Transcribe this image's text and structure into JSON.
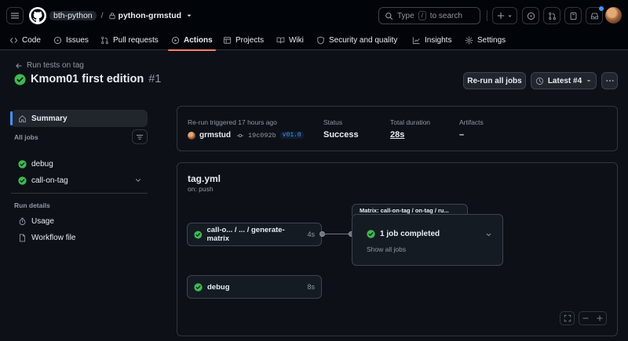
{
  "topbar": {
    "owner": "bth-python",
    "separator": "/",
    "repo": "python-grmstud",
    "search_prefix": "Type",
    "search_key": "/",
    "search_suffix": "to search"
  },
  "tabs": [
    {
      "label": "Code",
      "icon": "code-icon"
    },
    {
      "label": "Issues",
      "icon": "issue-icon"
    },
    {
      "label": "Pull requests",
      "icon": "pull-request-icon"
    },
    {
      "label": "Actions",
      "icon": "play-icon",
      "active": true
    },
    {
      "label": "Projects",
      "icon": "table-icon"
    },
    {
      "label": "Wiki",
      "icon": "book-icon"
    },
    {
      "label": "Security and quality",
      "icon": "shield-icon"
    },
    {
      "label": "Insights",
      "icon": "graph-icon"
    },
    {
      "label": "Settings",
      "icon": "gear-icon"
    }
  ],
  "header": {
    "back_label": "Run tests on tag",
    "title": "Kmom01 first edition",
    "run_number": "#1",
    "rerun_label": "Re-run all jobs",
    "latest_label": "Latest #4"
  },
  "sidebar": {
    "summary_label": "Summary",
    "all_jobs_label": "All jobs",
    "jobs": [
      "debug",
      "call-on-tag"
    ],
    "run_details_label": "Run details",
    "details": [
      "Usage",
      "Workflow file"
    ]
  },
  "summary": {
    "trigger_text": "Re-run triggered 17 hours ago",
    "user": "grmstud",
    "commit_sha": "19c092b",
    "tag": "v01.0",
    "status_label": "Status",
    "status_value": "Success",
    "duration_label": "Total duration",
    "duration_value": "28s",
    "artifacts_label": "Artifacts",
    "artifacts_value": "–"
  },
  "graph": {
    "workflow_file": "tag.yml",
    "trigger": "on: push",
    "job1_label": "call-o... / ... / generate-matrix",
    "job1_time": "4s",
    "matrix_title": "Matrix: call-on-tag / on-tag / ru...",
    "matrix_status": "1 job completed",
    "matrix_show_all": "Show all jobs",
    "job2_label": "debug",
    "job2_time": "8s"
  },
  "colors": {
    "success": "#3fb950",
    "accent": "#f78166",
    "link": "#4493f8",
    "background": "#0d1117"
  }
}
